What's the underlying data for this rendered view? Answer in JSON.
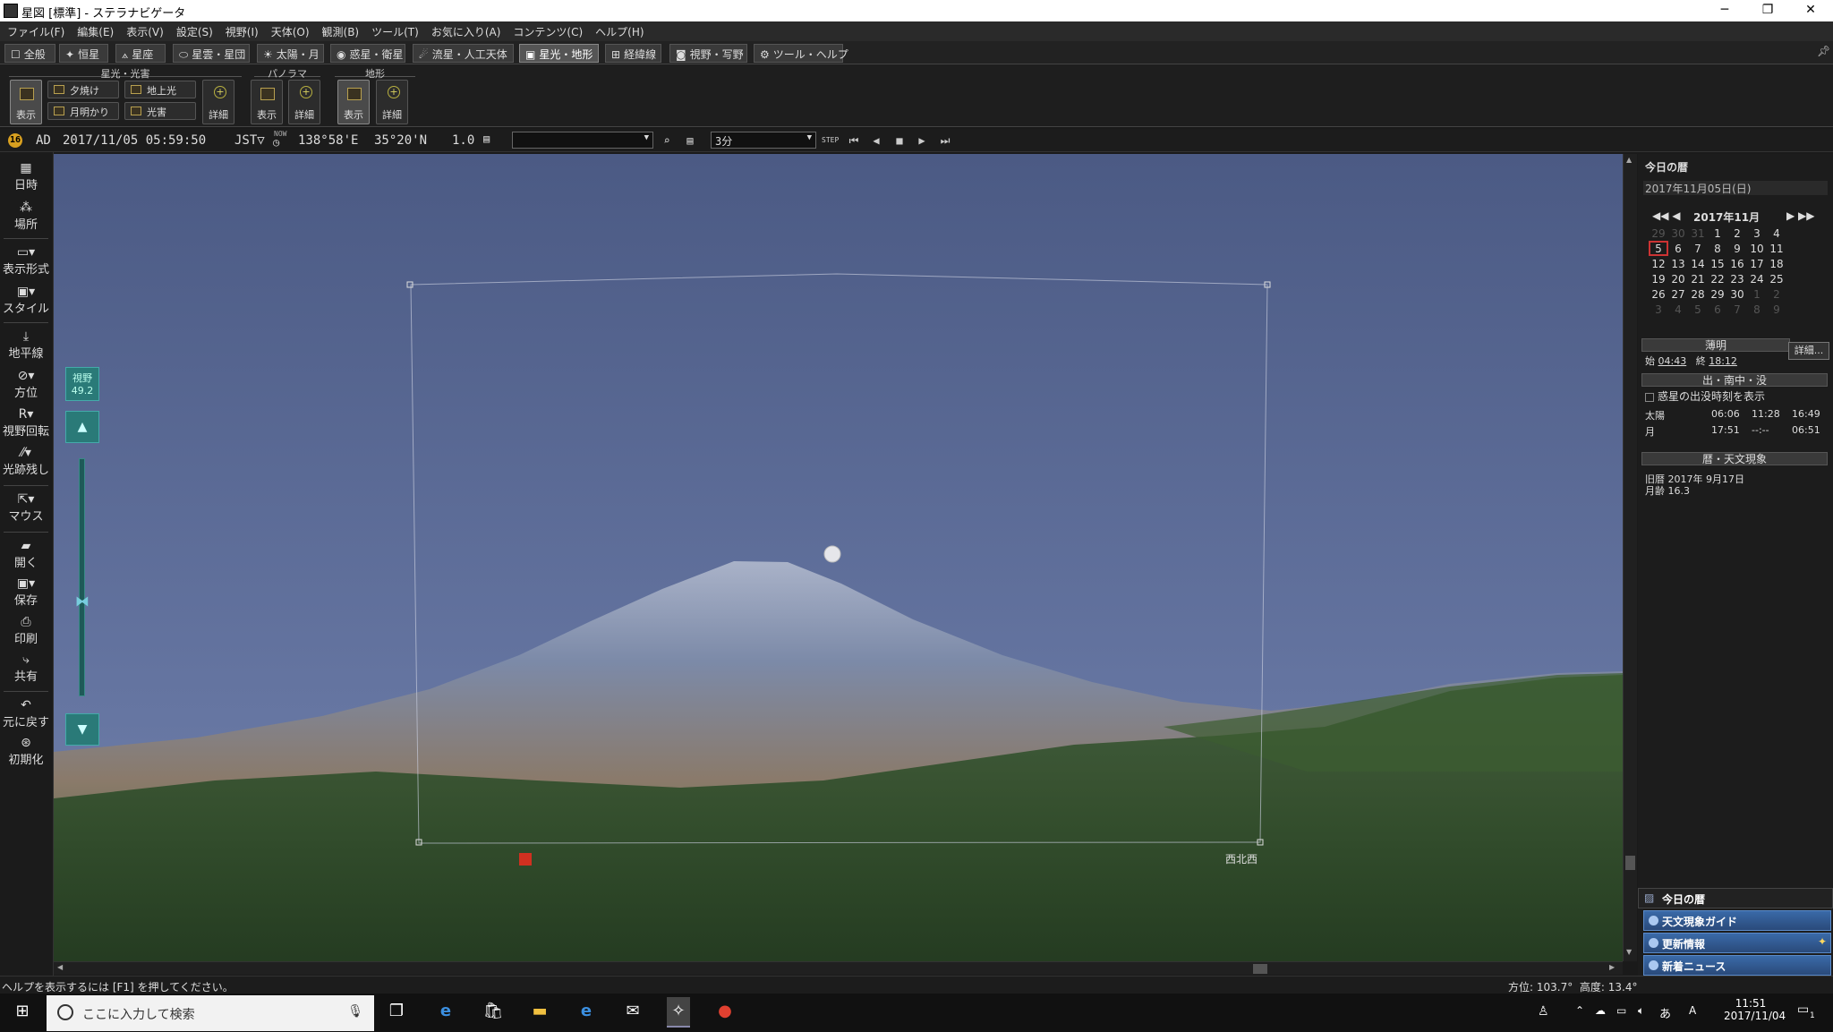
{
  "window": {
    "title": "星図 [標準] - ステラナビゲータ",
    "controls": [
      "─",
      "❐",
      "✕"
    ]
  },
  "menu": [
    "ファイル(F)",
    "編集(E)",
    "表示(V)",
    "設定(S)",
    "視野(I)",
    "天体(O)",
    "観測(B)",
    "ツール(T)",
    "お気に入り(A)",
    "コンテンツ(C)",
    "ヘルプ(H)"
  ],
  "tabs": [
    {
      "label": "全般",
      "icon": "checkbox-icon"
    },
    {
      "label": "恒星",
      "icon": "star-icon"
    },
    {
      "label": "星座",
      "icon": "constellation-icon"
    },
    {
      "label": "星雲・星団",
      "icon": "nebula-icon"
    },
    {
      "label": "太陽・月",
      "icon": "sun-icon"
    },
    {
      "label": "惑星・衛星",
      "icon": "planet-icon"
    },
    {
      "label": "流星・人工天体",
      "icon": "meteor-icon"
    },
    {
      "label": "星光・地形",
      "icon": "terrain-icon"
    },
    {
      "label": "経緯線",
      "icon": "grid-icon"
    },
    {
      "label": "視野・写野",
      "icon": "camera-icon"
    },
    {
      "label": "ツール・ヘルプ",
      "icon": "gear-icon"
    }
  ],
  "active_tab": "星光・地形",
  "ribbon": {
    "groups": [
      "星光・光害",
      "パノラマ",
      "地形"
    ],
    "starlight_show": "表示",
    "twilight": "夕焼け",
    "moonlight": "月明かり",
    "earthshine": "地上光",
    "light_pollution": "光害",
    "detail": "詳細",
    "panorama_show": "表示",
    "panorama_detail": "詳細",
    "terrain_show": "表示",
    "terrain_detail": "詳細"
  },
  "status": {
    "era": "AD",
    "datetime": "2017/11/05 05:59:50",
    "tz": "JST▽",
    "now_label": "NOW",
    "longitude": "138°58'E",
    "latitude": "35°20'N",
    "speed": "1.0",
    "step": "3分",
    "step_label": "STEP"
  },
  "left_tools": [
    "日時",
    "場所",
    "表示形式",
    "スタイル",
    "地平線",
    "方位",
    "視野回転",
    "光跡残し",
    "マウス",
    "開く",
    "保存",
    "印刷",
    "共有",
    "元に戻す",
    "初期化"
  ],
  "fov": {
    "label": "視野",
    "value": "49.2"
  },
  "view": {
    "direction_label": "西北西",
    "colors": {
      "sky_top": "#4f5d86",
      "sky_bottom": "#7080a8",
      "ground": "#2a4a28"
    }
  },
  "right_panel": {
    "title": "今日の暦",
    "date": "2017年11月05日(日)",
    "month": "2017年11月",
    "cal": [
      [
        [
          "29",
          0
        ],
        [
          "30",
          0
        ],
        [
          "31",
          0
        ],
        [
          "1",
          1
        ],
        [
          "2",
          1
        ],
        [
          "3",
          1
        ],
        [
          "4",
          1
        ]
      ],
      [
        [
          "5",
          1
        ],
        [
          "6",
          1
        ],
        [
          "7",
          1
        ],
        [
          "8",
          1
        ],
        [
          "9",
          1
        ],
        [
          "10",
          1
        ],
        [
          "11",
          1
        ]
      ],
      [
        [
          "12",
          1
        ],
        [
          "13",
          1
        ],
        [
          "14",
          1
        ],
        [
          "15",
          1
        ],
        [
          "16",
          1
        ],
        [
          "17",
          1
        ],
        [
          "18",
          1
        ]
      ],
      [
        [
          "19",
          1
        ],
        [
          "20",
          1
        ],
        [
          "21",
          1
        ],
        [
          "22",
          1
        ],
        [
          "23",
          1
        ],
        [
          "24",
          1
        ],
        [
          "25",
          1
        ]
      ],
      [
        [
          "26",
          1
        ],
        [
          "27",
          1
        ],
        [
          "28",
          1
        ],
        [
          "29",
          1
        ],
        [
          "30",
          1
        ],
        [
          "1",
          0
        ],
        [
          "2",
          0
        ]
      ],
      [
        [
          "3",
          0
        ],
        [
          "4",
          0
        ],
        [
          "5",
          0
        ],
        [
          "6",
          0
        ],
        [
          "7",
          0
        ],
        [
          "8",
          0
        ],
        [
          "9",
          0
        ]
      ]
    ],
    "twilight_header": "薄明",
    "twilight_start_label": "始",
    "twilight_start": "04:43",
    "twilight_end_label": "終",
    "twilight_end": "18:12",
    "detail_btn": "詳細...",
    "rise_header": "出・南中・没",
    "planet_checkbox": "惑星の出没時刻を表示",
    "rise_rows": [
      {
        "name": "太陽",
        "rise": "06:06",
        "transit": "11:28",
        "set": "16:49"
      },
      {
        "name": "月",
        "rise": "17:51",
        "transit": "--:--",
        "set": "06:51"
      }
    ],
    "phen_header": "暦・天文現象",
    "old_cal_label": "旧暦",
    "old_cal": "2017年 9月17日",
    "moon_age_label": "月齢",
    "moon_age": "16.3",
    "links": [
      "今日の暦",
      "天文現象ガイド",
      "更新情報",
      "新着ニュース"
    ]
  },
  "statusbar": {
    "help": "ヘルプを表示するには [F1] を押してください。",
    "az_label": "方位:",
    "az": "103.7°",
    "alt_label": "高度:",
    "alt": "13.4°"
  },
  "taskbar": {
    "search_placeholder": "ここに入力して検索",
    "time": "11:51",
    "date": "2017/11/04",
    "ime": "あ",
    "notif": "1"
  }
}
